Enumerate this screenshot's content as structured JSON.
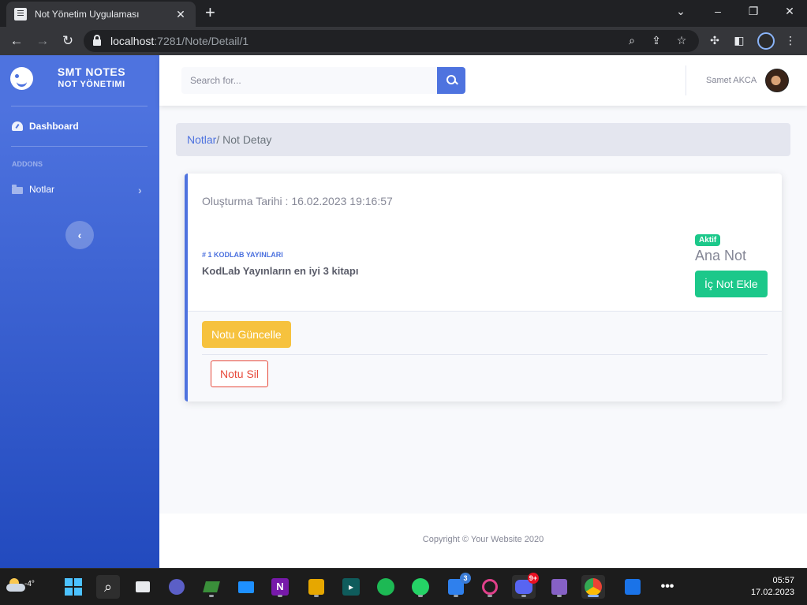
{
  "browser": {
    "tab_title": "Not Yönetim Uygulaması",
    "url_host": "localhost",
    "url_path": ":7281/Note/Detail/1"
  },
  "sidebar": {
    "brand_title": "SMT NOTES",
    "brand_subtitle": "NOT YÖNETIMI",
    "dashboard_label": "Dashboard",
    "addons_heading": "ADDONS",
    "notes_label": "Notlar"
  },
  "topbar": {
    "search_placeholder": "Search for...",
    "user_name": "Samet AKCA"
  },
  "breadcrumb": {
    "link": "Notlar",
    "active": "/ Not Detay"
  },
  "note": {
    "created": "Oluşturma Tarihi : 16.02.2023 19:16:57",
    "tag": "# 1 KODLAB YAYINLARI",
    "title": "KodLab Yayınların en iyi 3 kitapı",
    "status_badge": "Aktif",
    "type": "Ana Not",
    "add_sub_note_label": "İç Not Ekle",
    "update_label": "Notu Güncelle",
    "delete_label": "Notu Sil"
  },
  "footer": {
    "copyright": "Copyright © Your Website 2020"
  },
  "taskbar": {
    "weather_temp": "-4°",
    "time": "05:57",
    "date": "17.02.2023",
    "vscode_badge": "3",
    "discord_badge": "9+"
  },
  "colors": {
    "primary": "#4e73df",
    "success": "#1cc88a",
    "warning": "#f6c23e",
    "danger": "#e74a3b"
  }
}
